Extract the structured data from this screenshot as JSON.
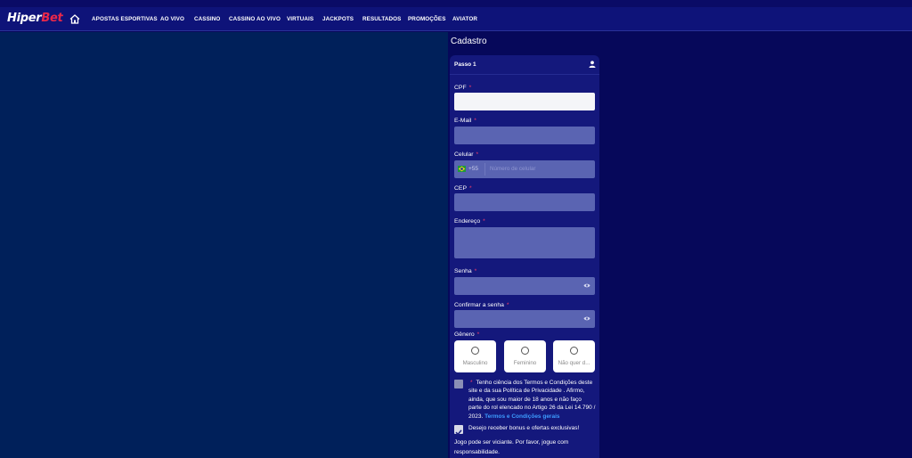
{
  "brand": {
    "logo_part1": "Hiper",
    "logo_part2": "Bet",
    "accent": "#e8284a"
  },
  "nav": {
    "home_icon": "home-icon",
    "items": [
      "APOSTAS ESPORTIVAS",
      "AO VIVO",
      "CASSINO",
      "CASSINO AO VIVO",
      "VIRTUAIS",
      "JACKPOTS",
      "RESULTADOS",
      "PROMOÇÕES",
      "AVIATOR"
    ]
  },
  "form": {
    "title": "Cadastro",
    "step": "Passo 1",
    "step_icon": "user-icon",
    "required_mark": "*",
    "fields": {
      "cpf": {
        "label": "CPF",
        "value": ""
      },
      "email": {
        "label": "E-Mail",
        "value": ""
      },
      "phone": {
        "label": "Celular",
        "code": "+55",
        "placeholder": "Número de celular",
        "flag": "brazil-flag-icon"
      },
      "cep": {
        "label": "CEP",
        "value": ""
      },
      "address": {
        "label": "Endereço",
        "value": ""
      },
      "password": {
        "label": "Senha",
        "value": ""
      },
      "confirm_password": {
        "label": "Confirmar a senha",
        "value": ""
      }
    },
    "gender": {
      "label": "Gênero",
      "options": [
        "Masculino",
        "Feminino",
        "Não quer d..."
      ]
    },
    "terms": {
      "checked": false,
      "text": "Tenho ciência dos Termos e Condições deste site e da sua Política de Privacidade . Afirmo, ainda, que sou maior de 18 anos e não faço parte do rol elencado no Artigo 26 da Lei 14.790 / 2023.",
      "link": "Termos e Condições gerais"
    },
    "bonus": {
      "checked": true,
      "text": "Desejo receber bonus e ofertas exclusivas!"
    },
    "warning": "Jogo pode ser viciante. Por favor, jogue com responsabilidade."
  },
  "colors": {
    "nav_bg": "#0e1379",
    "left_bg": "#00205a",
    "card_bg": "#14187c",
    "input_bg": "#5a64b2",
    "link": "#3d9cff",
    "required": "#ff3d6a"
  }
}
